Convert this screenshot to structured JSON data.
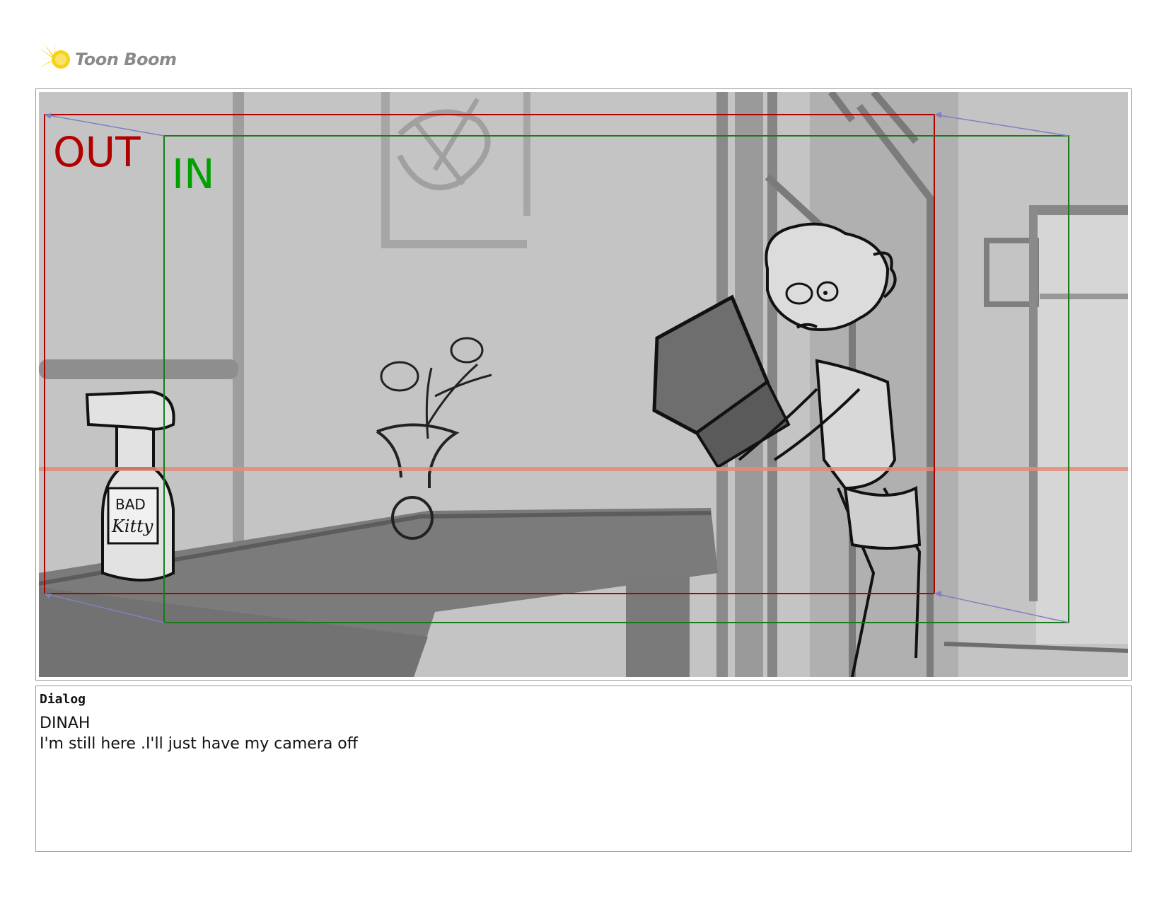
{
  "logo": {
    "text": "Toon Boom",
    "icon": "starburst-logo-icon",
    "accent_color": "#f5c400"
  },
  "panel": {
    "out_label": "OUT",
    "in_label": "IN",
    "out_color": "#b00000",
    "in_color": "#00a000",
    "bottle_label_line1": "BAD",
    "bottle_label_line2": "Kitty"
  },
  "dialog": {
    "section_label": "Dialog",
    "speaker": "DINAH",
    "line": "I'm still here .I'll just have my camera off"
  }
}
